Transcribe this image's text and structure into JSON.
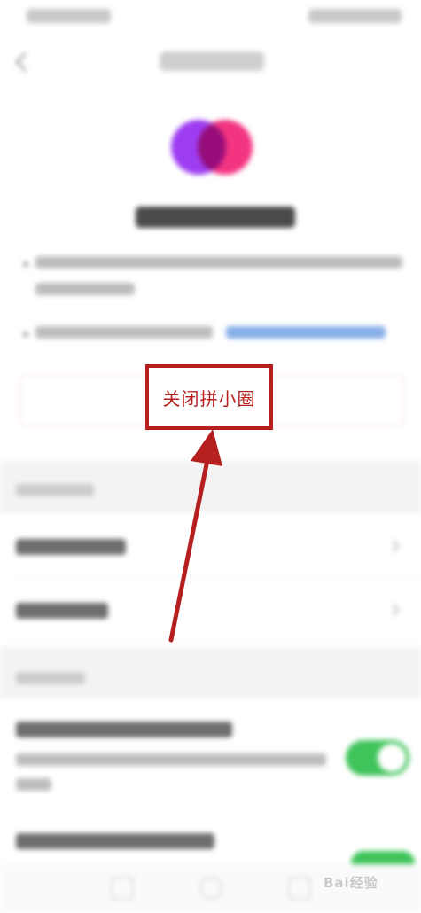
{
  "close_button": {
    "label": "关闭拼小圈"
  },
  "watermark": "Bai经验",
  "colors": {
    "accent_red": "#b51f1f",
    "toggle_green": "#3fc45a",
    "logo_purple": "#9d3df2",
    "logo_pink": "#f3297a",
    "link_blue": "#86aee8"
  },
  "icons": {
    "back": "chevron-left-icon",
    "row_chevron": "chevron-right-icon",
    "toggle": "toggle-switch-icon"
  },
  "toggles": [
    {
      "state": "on"
    },
    {
      "state": "on"
    }
  ]
}
